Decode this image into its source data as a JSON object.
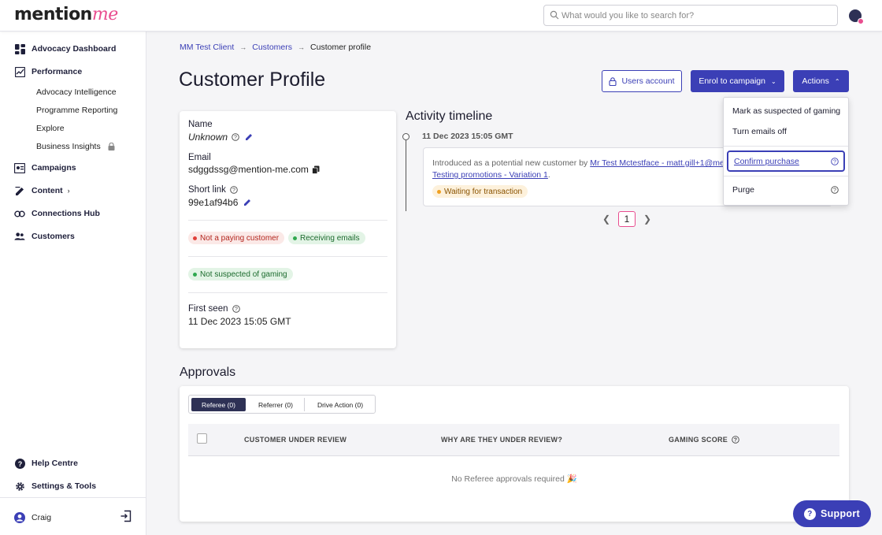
{
  "app": {
    "logo_text_a": "mention",
    "logo_text_b": "me",
    "search": {
      "placeholder": "What would you like to search for?"
    }
  },
  "sidebar": {
    "items": [
      {
        "label": "Advocacy Dashboard",
        "icon": "dashboard-icon"
      },
      {
        "label": "Performance",
        "icon": "chart-icon"
      },
      {
        "label": "Campaigns",
        "icon": "campaigns-icon"
      },
      {
        "label": "Content",
        "icon": "edit-icon"
      },
      {
        "label": "Connections Hub",
        "icon": "connections-icon"
      },
      {
        "label": "Customers",
        "icon": "customers-icon"
      }
    ],
    "subitems": [
      {
        "label": "Advocacy Intelligence"
      },
      {
        "label": "Programme Reporting"
      },
      {
        "label": "Explore"
      },
      {
        "label": "Business Insights"
      }
    ],
    "footer": [
      {
        "label": "Help Centre",
        "icon": "help-icon"
      },
      {
        "label": "Settings & Tools",
        "icon": "gear-icon"
      }
    ],
    "user": {
      "name": "Craig"
    }
  },
  "breadcrumb": {
    "items": [
      "MM Test Client",
      "Customers"
    ],
    "current": "Customer profile"
  },
  "page": {
    "title": "Customer Profile",
    "users_account_label": "Users account",
    "enrol_label": "Enrol to campaign",
    "actions_label": "Actions"
  },
  "profile": {
    "name_label": "Name",
    "name_value": "Unknown",
    "email_label": "Email",
    "email_value": "sdggdssg@mention-me.com",
    "short_link_label": "Short link",
    "short_link_value": "99e1af94b6",
    "badge_paying": "Not a paying customer",
    "badge_emails": "Receiving emails",
    "badge_gaming": "Not suspected of gaming",
    "first_seen_label": "First seen",
    "first_seen_value": "11 Dec 2023 15:05 GMT"
  },
  "timeline": {
    "title": "Activity timeline",
    "date": "11 Dec 2023 15:05 GMT",
    "text_prefix": "Introduced as a potential new customer by ",
    "link_referrer": "Mr Test Mctestface - matt.gill+1@ment",
    "link_campaign": "Testing promotions - Variation 1",
    "text_suffix": ".",
    "status_badge": "Waiting for transaction",
    "pagination": {
      "current_page": "1"
    }
  },
  "actions_menu": {
    "items": [
      "Mark as suspected of gaming",
      "Turn emails off",
      "Confirm purchase",
      "Purge"
    ]
  },
  "approvals": {
    "title": "Approvals",
    "tabs": [
      "Referee (0)",
      "Referrer (0)",
      "Drive Action (0)"
    ],
    "active_tab": "Referee (0)",
    "columns": [
      "CUSTOMER UNDER REVIEW",
      "WHY ARE THEY UNDER REVIEW?",
      "GAMING SCORE"
    ],
    "empty_message": "No Referee approvals required 🎉"
  },
  "support": {
    "label": "Support"
  },
  "colors": {
    "brand_primary": "#3b3fb6",
    "brand_pink": "#e94d8f",
    "navy": "#2e3155"
  }
}
